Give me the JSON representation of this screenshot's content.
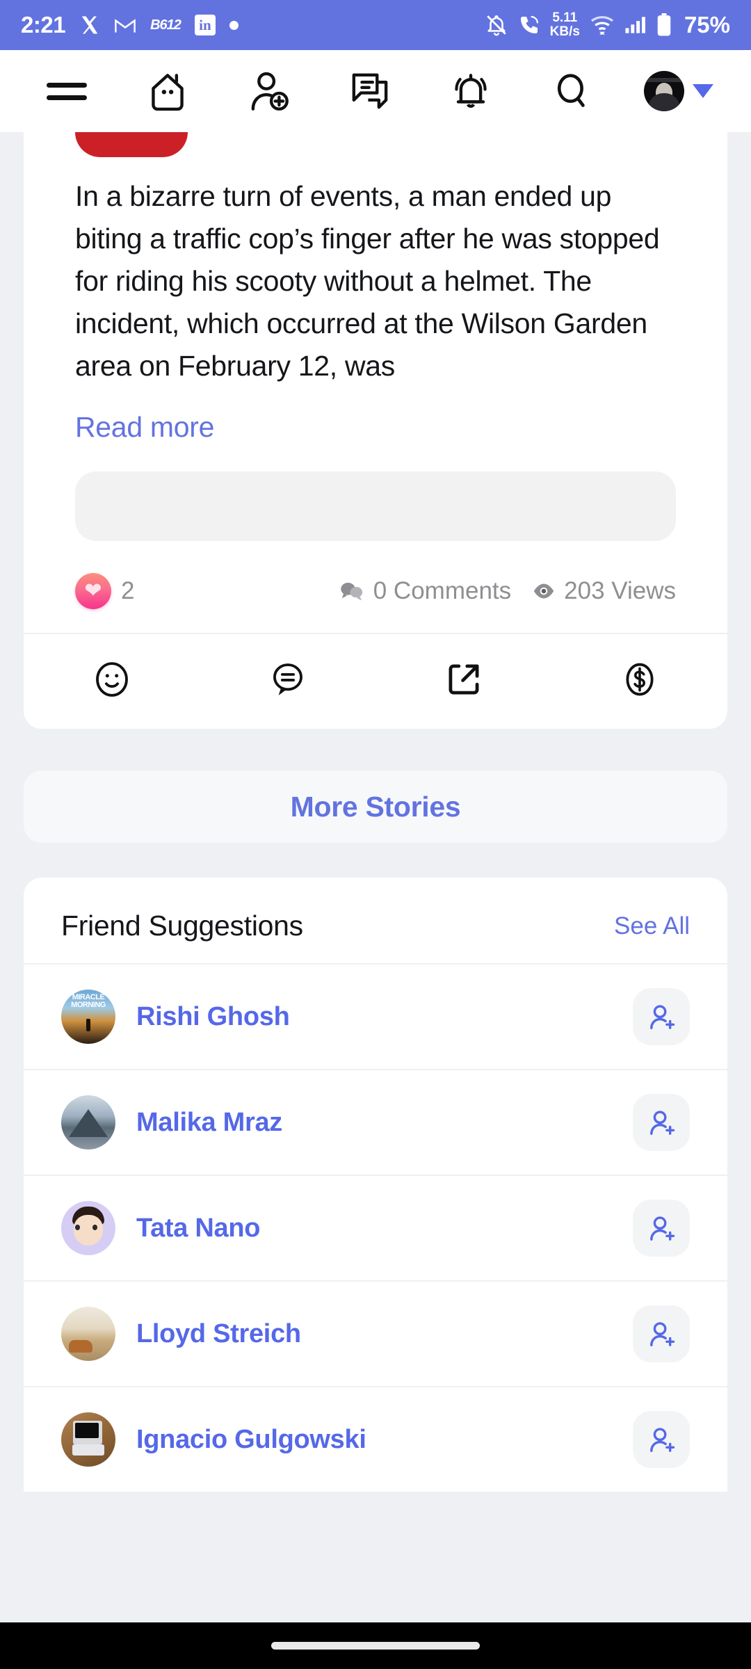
{
  "status_bar": {
    "time": "2:21",
    "app_icons": [
      "x-icon",
      "gmail-icon",
      "b612-icon",
      "linkedin-icon",
      "dot-indicator-icon"
    ],
    "b612_label": "B612",
    "linkedin_label": "in",
    "network_speed_value": "5.11",
    "network_speed_unit": "KB/s",
    "right_icons": [
      "notifications-off-icon",
      "call-forward-icon",
      "wifi-icon",
      "signal-icon",
      "battery-icon"
    ],
    "battery_percent": "75%",
    "background_color": "#6273e0"
  },
  "app_header": {
    "items": [
      {
        "name": "menu-icon",
        "label": "Menu"
      },
      {
        "name": "home-icon",
        "label": "Home"
      },
      {
        "name": "add-friend-icon",
        "label": "Add Friend"
      },
      {
        "name": "messages-icon",
        "label": "Messages"
      },
      {
        "name": "notifications-bell-icon",
        "label": "Notifications"
      },
      {
        "name": "search-icon",
        "label": "Search"
      }
    ],
    "avatar_label": "Profile",
    "caret_label": "Open profile menu"
  },
  "post": {
    "body": "In a bizarre turn of events, a man ended up biting a traffic cop’s finger after he was stopped for riding his scooty without a helmet. The incident, which occurred at the Wilson Garden area on February 12, was",
    "read_more_label": "Read more",
    "badge_color": "#cc2027",
    "reaction_count": "2",
    "comments_label": "0 Comments",
    "views_label": "203 Views",
    "actions": [
      {
        "name": "react-smiley-icon",
        "label": "React"
      },
      {
        "name": "comment-icon",
        "label": "Comment"
      },
      {
        "name": "share-icon",
        "label": "Share"
      },
      {
        "name": "tip-dollar-icon",
        "label": "Tip"
      }
    ]
  },
  "more_stories": {
    "label": "More Stories"
  },
  "friend_suggestions": {
    "title": "Friend Suggestions",
    "see_all_label": "See All",
    "add_button_label": "Add Friend",
    "people": [
      {
        "name": "Rishi Ghosh",
        "avatar": "book-cover-photo",
        "avatar_text": "MIRACLE MORNING"
      },
      {
        "name": "Malika Mraz",
        "avatar": "mountain-photo",
        "avatar_text": ""
      },
      {
        "name": "Tata Nano",
        "avatar": "memoji-avatar",
        "avatar_text": ""
      },
      {
        "name": "Lloyd Streich",
        "avatar": "desert-animal-photo",
        "avatar_text": ""
      },
      {
        "name": "Ignacio Gulgowski",
        "avatar": "laptop-desk-photo",
        "avatar_text": ""
      }
    ]
  },
  "theme": {
    "accent": "#6273e0",
    "link": "#5568e8",
    "page_background": "#eef0f4",
    "card_background": "#ffffff",
    "muted_text": "#8e8e93"
  }
}
